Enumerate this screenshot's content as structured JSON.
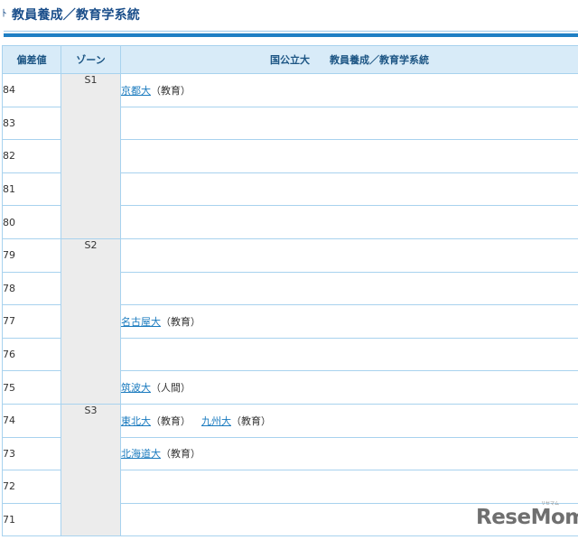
{
  "header": {
    "mark": "ﾄ",
    "title": "教員養成／教育学系統"
  },
  "table": {
    "columns": {
      "deviation": "偏差値",
      "zone": "ゾーン",
      "schools_a": "国公立大",
      "schools_b": "教員養成／教育学系統"
    },
    "zones": [
      {
        "name": "S1",
        "rows": [
          {
            "deviation": "84",
            "schools": [
              {
                "univ": "京都大",
                "faculty": "（教育）"
              }
            ]
          },
          {
            "deviation": "83",
            "schools": []
          },
          {
            "deviation": "82",
            "schools": []
          },
          {
            "deviation": "81",
            "schools": []
          },
          {
            "deviation": "80",
            "schools": []
          }
        ]
      },
      {
        "name": "S2",
        "rows": [
          {
            "deviation": "79",
            "schools": []
          },
          {
            "deviation": "78",
            "schools": []
          },
          {
            "deviation": "77",
            "schools": [
              {
                "univ": "名古屋大",
                "faculty": "（教育）"
              }
            ]
          },
          {
            "deviation": "76",
            "schools": []
          },
          {
            "deviation": "75",
            "schools": [
              {
                "univ": "筑波大",
                "faculty": "（人間）"
              }
            ]
          }
        ]
      },
      {
        "name": "S3",
        "rows": [
          {
            "deviation": "74",
            "schools": [
              {
                "univ": "東北大",
                "faculty": "（教育）"
              },
              {
                "univ": "九州大",
                "faculty": "（教育）"
              }
            ]
          },
          {
            "deviation": "73",
            "schools": [
              {
                "univ": "北海道大",
                "faculty": "（教育）"
              }
            ]
          },
          {
            "deviation": "72",
            "schools": []
          },
          {
            "deviation": "71",
            "schools": []
          }
        ]
      }
    ]
  },
  "watermark": {
    "logo": "ReseMom",
    "kana": "リセマム"
  }
}
